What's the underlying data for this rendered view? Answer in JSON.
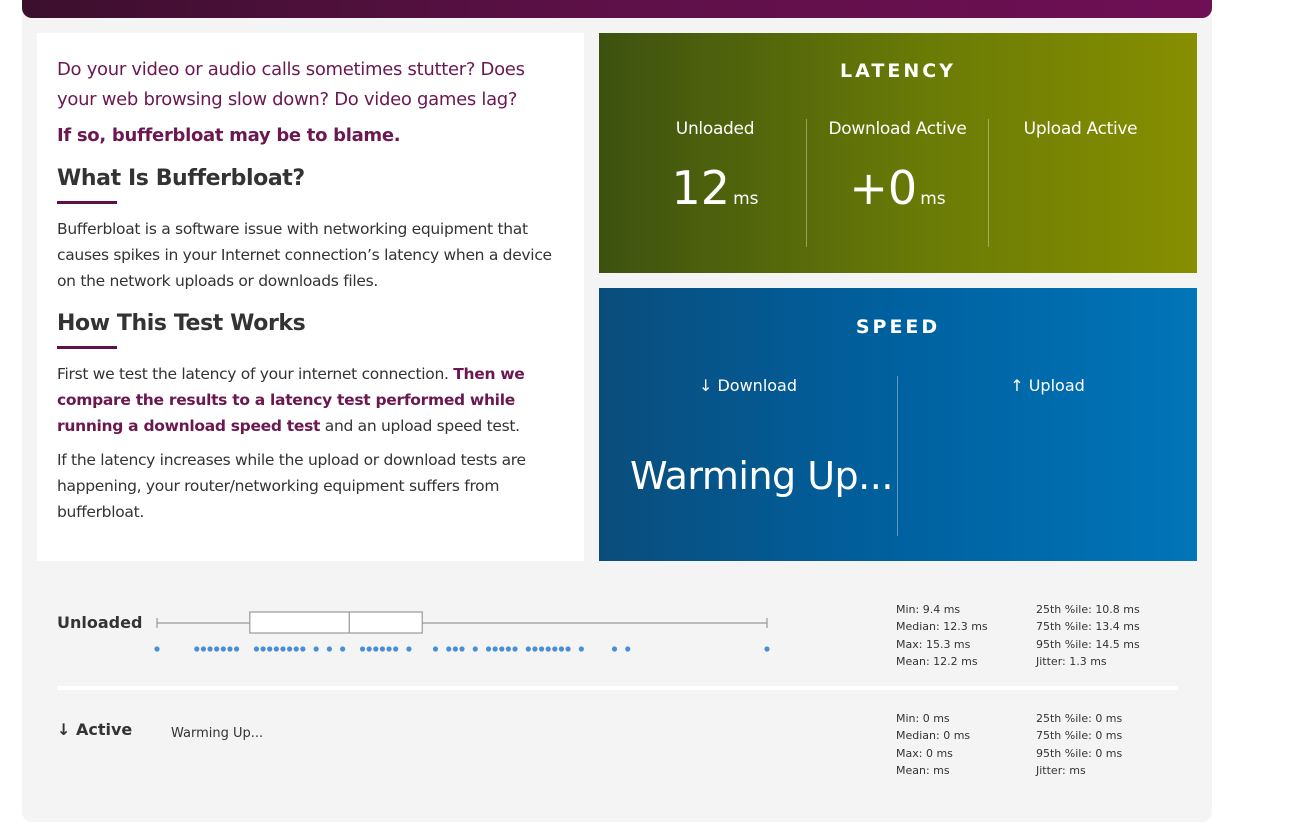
{
  "intro": {
    "question": "Do your video or audio calls sometimes stutter? Does your web browsing slow down? Do video games lag?",
    "blame": "If so, bufferbloat may be to blame."
  },
  "what": {
    "heading": "What Is Bufferbloat?",
    "text": "Bufferbloat is a software issue with networking equipment that causes spikes in your Internet connection’s latency when a device on the network uploads or downloads files."
  },
  "how": {
    "heading": "How This Test Works",
    "p1_start": "First we test the latency of your internet connection. ",
    "p1_bold": "Then we compare the results to a latency test performed while running a download speed test",
    "p1_end": " and an upload speed test.",
    "p2": "If the latency increases while the upload or download tests are happening, your router/networking equipment suffers from bufferbloat."
  },
  "latency": {
    "title": "LATENCY",
    "unloaded_label": "Unloaded",
    "unloaded_value": "12",
    "download_label": "Download Active",
    "download_value": "+0",
    "upload_label": "Upload Active",
    "unit": "ms"
  },
  "speed": {
    "title": "SPEED",
    "download_label": "↓ Download",
    "upload_label": "↑ Upload",
    "status": "Warming Up..."
  },
  "unloaded_row": {
    "label": "Unloaded",
    "stats": {
      "min": "Min: 9.4 ms",
      "median": "Median: 12.3 ms",
      "max": "Max: 15.3 ms",
      "mean": "Mean: 12.2 ms",
      "p25": "25th %ile: 10.8 ms",
      "p75": "75th %ile: 13.4 ms",
      "p95": "95th %ile: 14.5 ms",
      "jitter": "Jitter: 1.3 ms"
    },
    "boxplot": {
      "min": 9.4,
      "q1": 10.8,
      "median": 12.3,
      "q3": 13.4,
      "max": 15.3
    },
    "samples": [
      9.4,
      10.0,
      10.1,
      10.2,
      10.3,
      10.4,
      10.5,
      10.6,
      10.9,
      11.0,
      11.1,
      11.2,
      11.3,
      11.4,
      11.5,
      11.6,
      11.8,
      12.0,
      12.2,
      12.5,
      12.6,
      12.7,
      12.8,
      12.9,
      13.0,
      13.2,
      13.6,
      13.8,
      13.9,
      14.0,
      14.2,
      14.4,
      14.5,
      14.6,
      14.7,
      14.8,
      15.0,
      15.1,
      15.2,
      15.3,
      15.4,
      15.5,
      15.6,
      15.8,
      16.3,
      16.5,
      18.6
    ]
  },
  "active_row": {
    "label": "↓ Active",
    "status": "Warming Up...",
    "stats": {
      "min": "Min: 0 ms",
      "median": "Median: 0 ms",
      "max": "Max: 0 ms",
      "mean": "Mean:  ms",
      "p25": "25th %ile: 0 ms",
      "p75": "75th %ile: 0 ms",
      "p95": "95th %ile: 0 ms",
      "jitter": "Jitter:  ms"
    }
  },
  "colors": {
    "brand": "#6b1750",
    "latency_start": "#3d5210",
    "latency_end": "#878f00",
    "speed_start": "#0a4d7c",
    "speed_end": "#0075b8",
    "dot": "#4a8fd6"
  }
}
